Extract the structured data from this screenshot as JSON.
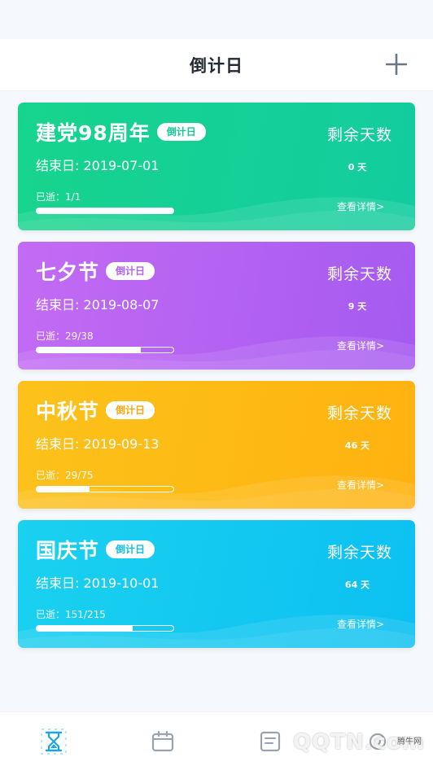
{
  "header": {
    "title": "倒计日"
  },
  "colors": {
    "card_1_from": "#17d48d",
    "card_1_to": "#13cc9f",
    "card_2_from": "#c36bf4",
    "card_2_to": "#a55af0",
    "card_3_from": "#fcc21b",
    "card_3_to": "#ffb20f",
    "card_4_from": "#1bd1f0",
    "card_4_to": "#0cc0f1",
    "active_tab": "#1aa5e8",
    "inactive_tab": "#9aa3ad"
  },
  "cards": [
    {
      "title": "建党98周年",
      "tag": "倒计日",
      "end_date": "结束日: 2019-07-01",
      "elapsed": "已逝：1/1",
      "progress": 1.0,
      "remain_label": "剩余天数",
      "remain_days": "0 天",
      "detail": "查看详情>",
      "tag_color": "#16c995"
    },
    {
      "title": "七夕节",
      "tag": "倒计日",
      "end_date": "结束日: 2019-08-07",
      "elapsed": "已逝：29/38",
      "progress": 0.763,
      "remain_label": "剩余天数",
      "remain_days": "9 天",
      "detail": "查看详情>",
      "tag_color": "#b262f2"
    },
    {
      "title": "中秋节",
      "tag": "倒计日",
      "end_date": "结束日: 2019-09-13",
      "elapsed": "已逝：29/75",
      "progress": 0.387,
      "remain_label": "剩余天数",
      "remain_days": "46 天",
      "detail": "查看详情>",
      "tag_color": "#f3aa12"
    },
    {
      "title": "国庆节",
      "tag": "倒计日",
      "end_date": "结束日: 2019-10-01",
      "elapsed": "已逝：151/215",
      "progress": 0.702,
      "remain_label": "剩余天数",
      "remain_days": "64 天",
      "detail": "查看详情>",
      "tag_color": "#12bde8"
    }
  ],
  "tabs": [
    {
      "icon": "hourglass-icon",
      "active": true
    },
    {
      "icon": "calendar-icon",
      "active": false
    },
    {
      "icon": "notes-icon",
      "active": false
    },
    {
      "icon": "settings-icon",
      "active": false
    }
  ],
  "watermark": {
    "text": "QQTN.com",
    "small": "腾牛网"
  }
}
